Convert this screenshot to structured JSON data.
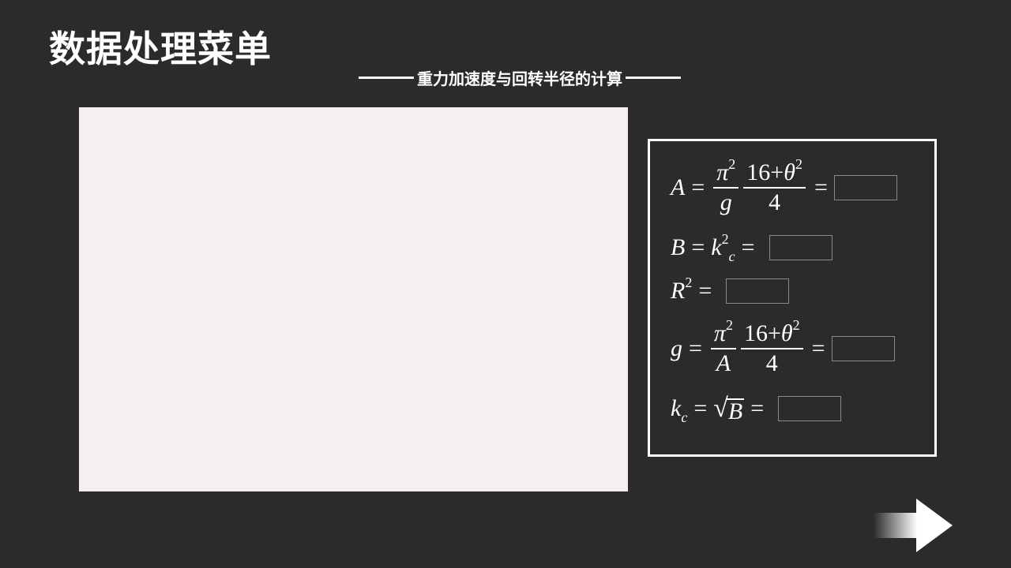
{
  "page": {
    "title": "数据处理菜单",
    "subtitle": "重力加速度与回转半径的计算"
  },
  "formulas": {
    "A": {
      "lhs": "A",
      "eq": "=",
      "pi": "π",
      "pow2": "2",
      "den1": "g",
      "num2a": "16",
      "plus": "+",
      "theta": "θ",
      "den2": "4",
      "answer": ""
    },
    "B": {
      "lhs": "B",
      "eq": "=",
      "k": "k",
      "c": "c",
      "pow2": "2",
      "answer": ""
    },
    "R": {
      "lhs": "R",
      "pow2": "2",
      "eq": "=",
      "answer": ""
    },
    "g": {
      "lhs": "g",
      "eq": "=",
      "pi": "π",
      "pow2": "2",
      "den1": "A",
      "num2a": "16",
      "plus": "+",
      "theta": "θ",
      "den2": "4",
      "answer": ""
    },
    "kc": {
      "k": "k",
      "c": "c",
      "eq": "=",
      "sqrt": "√",
      "B": "B",
      "answer": ""
    }
  },
  "colors": {
    "background": "#2c2a2b",
    "canvas": "#f5efef",
    "foreground": "#ffffff"
  },
  "icons": {
    "next": "arrow-right-icon"
  }
}
